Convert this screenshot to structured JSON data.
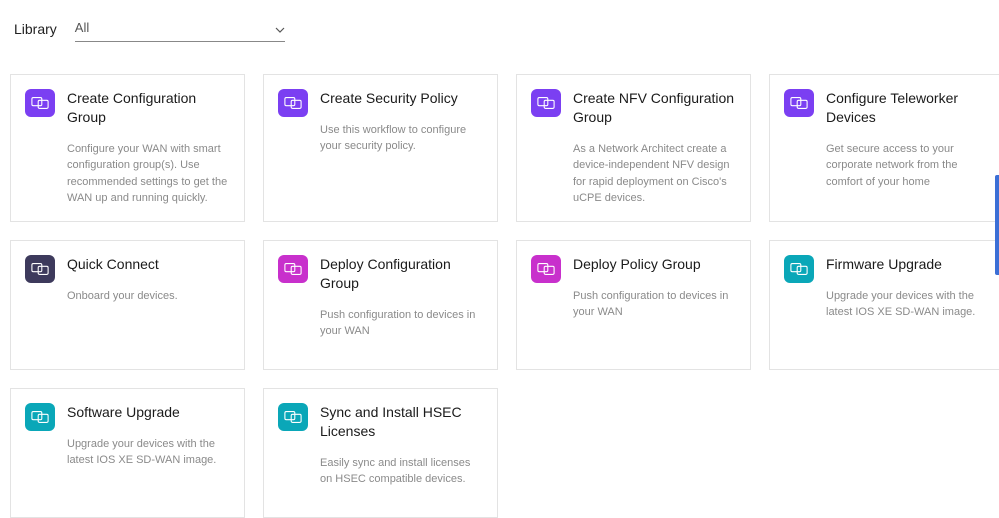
{
  "filter": {
    "label": "Library",
    "selected": "All"
  },
  "icon_colors": {
    "purple": "#7b3ff2",
    "darkpurple": "#3d3a5c",
    "magenta": "#c830cc",
    "teal": "#0aa7b8"
  },
  "cards": [
    {
      "title": "Create Configuration Group",
      "desc": "Configure your WAN with smart configuration group(s). Use recommended settings to get the WAN up and running quickly.",
      "color": "purple"
    },
    {
      "title": "Create Security Policy",
      "desc": "Use this workflow to configure your security policy.",
      "color": "purple"
    },
    {
      "title": "Create NFV Configuration Group",
      "desc": "As a Network Architect create a device-independent NFV design for rapid deployment on Cisco's uCPE devices.",
      "color": "purple"
    },
    {
      "title": "Configure Teleworker Devices",
      "desc": "Get secure access to your corporate network from the comfort of your home",
      "color": "purple"
    },
    {
      "title": "Quick Connect",
      "desc": "Onboard your devices.",
      "color": "darkpurple"
    },
    {
      "title": "Deploy Configuration Group",
      "desc": "Push configuration to devices in your WAN",
      "color": "magenta"
    },
    {
      "title": "Deploy Policy Group",
      "desc": "Push configuration to devices in your WAN",
      "color": "magenta"
    },
    {
      "title": "Firmware Upgrade",
      "desc": "Upgrade your devices with the latest IOS XE SD-WAN image.",
      "color": "teal"
    },
    {
      "title": "Software Upgrade",
      "desc": "Upgrade your devices with the latest IOS XE SD-WAN image.",
      "color": "teal"
    },
    {
      "title": "Sync and Install HSEC Licenses",
      "desc": "Easily sync and install licenses on HSEC compatible devices.",
      "color": "teal"
    }
  ]
}
